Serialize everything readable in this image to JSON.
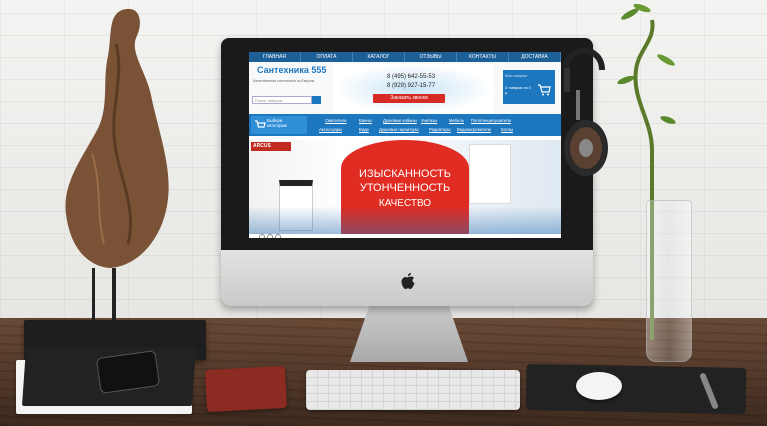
{
  "site": {
    "nav": [
      "ГЛАВНАЯ",
      "ОПЛАТА",
      "КАТАЛОГ",
      "ОТЗЫВЫ",
      "КОНТАКТЫ",
      "ДОСТАВКА"
    ],
    "logo": "Сантехника 555",
    "slogan": "Качественная сантехника из Европы",
    "search_placeholder": "Поиск товаров...",
    "phone1": "8 (495) 642-55-53",
    "phone2": "8 (929) 927-15-77",
    "call_button": "Заказать звонок",
    "cart_label": "Мои покупки",
    "cart_count": "0 товаров на 0 р.",
    "catalog_button": "Выбери категорию",
    "categories_row1": [
      "Смесители",
      "Ванны",
      "Душевые кабины",
      "Унитазы",
      "Мебель",
      "Полотенцесушители"
    ],
    "categories_row2": [
      "Аксессуары",
      "Биде",
      "Душевые гарнитуры",
      "Радиаторы",
      "Водонагреватели",
      "Котлы"
    ],
    "banner_brand": "ARCUS",
    "banner_line1": "ИЗЫСКАННОСТЬ",
    "banner_line2": "УТОНЧЕННОСТЬ",
    "banner_line3": "КАЧЕСТВО"
  },
  "colors": {
    "nav_blue": "#1d5f97",
    "accent_blue": "#1d77bf",
    "banner_red": "#e02c22",
    "call_red": "#d62a24"
  }
}
